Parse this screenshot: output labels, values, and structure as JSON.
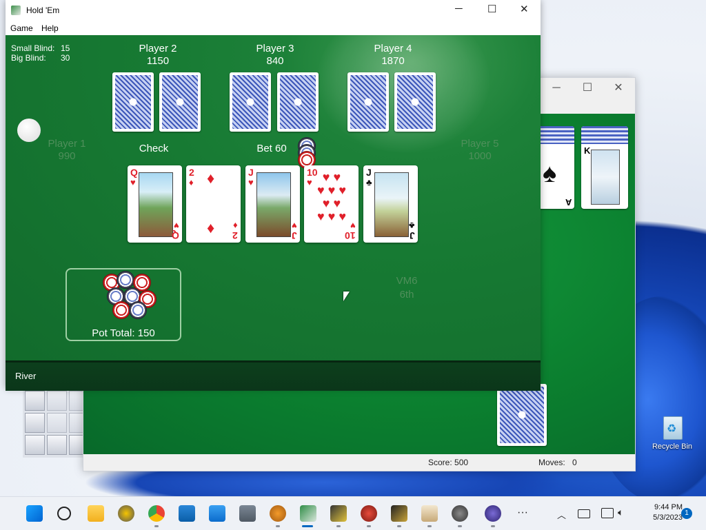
{
  "holdem": {
    "title": "Hold 'Em",
    "menu": [
      "Game",
      "Help"
    ],
    "blinds": {
      "small_label": "Small Blind:",
      "small_value": "15",
      "big_label": "Big Blind:",
      "big_value": "30"
    },
    "players": [
      {
        "name": "Player 1",
        "chips": "990",
        "action": ""
      },
      {
        "name": "Player 2",
        "chips": "1150",
        "action": "Check"
      },
      {
        "name": "Player 3",
        "chips": "840",
        "action": "Bet 60"
      },
      {
        "name": "Player 4",
        "chips": "1870",
        "action": ""
      },
      {
        "name": "Player 5",
        "chips": "1000",
        "action": ""
      }
    ],
    "community_cards": [
      {
        "rank": "Q",
        "suit": "♥",
        "color": "#e0202a"
      },
      {
        "rank": "2",
        "suit": "♦",
        "color": "#e0202a"
      },
      {
        "rank": "J",
        "suit": "♥",
        "color": "#e0202a"
      },
      {
        "rank": "10",
        "suit": "♥",
        "color": "#e0202a"
      },
      {
        "rank": "J",
        "suit": "♣",
        "color": "#111111"
      }
    ],
    "pot_total": "Pot Total: 150",
    "player_you": {
      "name": "VM6",
      "place": "6th"
    },
    "status": "River",
    "felt_color": "#177a33"
  },
  "solitaire": {
    "score": "Score: 500",
    "moves_label": "Moves:",
    "moves_value": "0",
    "card_k": "K",
    "card_a": "A",
    "felt_color": "#0b7f2f"
  },
  "desktop": {
    "recycle_bin": "Recycle Bin"
  },
  "taskbar": {
    "time": "9:44 PM",
    "date": "5/3/2023",
    "notification_count": "1",
    "more_label": "···"
  }
}
